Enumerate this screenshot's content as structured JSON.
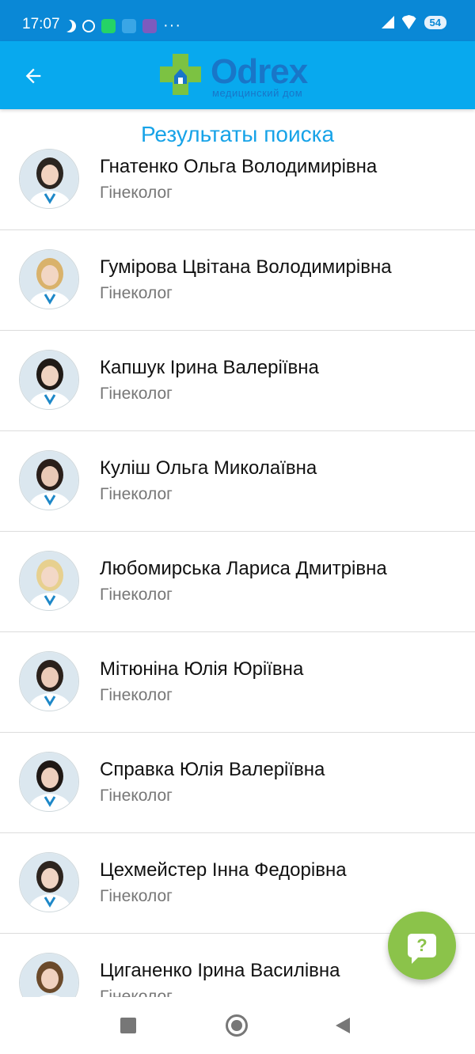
{
  "status_bar": {
    "time": "17:07",
    "dots": "···",
    "battery": "54"
  },
  "header": {
    "logo_word": "Odrex",
    "logo_sub": "медицинский дом"
  },
  "page_title": "Результаты поиска",
  "doctors": [
    {
      "name": "Гнатенко Ольга Володимирівна",
      "specialty": "Гінеколог",
      "hair": "#2b2520",
      "skin": "#f1d3c0"
    },
    {
      "name": "Гумірова Цвітана Володимирівна",
      "specialty": "Гінеколог",
      "hair": "#d9b26b",
      "skin": "#f2d6c4"
    },
    {
      "name": "Капшук Ірина Валеріївна",
      "specialty": "Гінеколог",
      "hair": "#201a16",
      "skin": "#efd3c1"
    },
    {
      "name": "Куліш Ольга Миколаївна",
      "specialty": "Гінеколог",
      "hair": "#2a1f1a",
      "skin": "#e9c9b6"
    },
    {
      "name": "Любомирська Лариса Дмитрівна",
      "specialty": "Гінеколог",
      "hair": "#e7d08f",
      "skin": "#f3d8c7"
    },
    {
      "name": "Мітюніна Юлія Юріївна",
      "specialty": "Гінеколог",
      "hair": "#2b211b",
      "skin": "#eccbb8"
    },
    {
      "name": "Справка Юлія Валеріївна",
      "specialty": "Гінеколог",
      "hair": "#1f1815",
      "skin": "#eecfbd"
    },
    {
      "name": "Цехмейстер Інна Федорівна",
      "specialty": "Гінеколог",
      "hair": "#2d241e",
      "skin": "#f0d4c3"
    },
    {
      "name": "Циганенко Ірина Василівна",
      "specialty": "Гінеколог",
      "hair": "#6b4a2b",
      "skin": "#f0d2c0"
    }
  ],
  "fab": {
    "symbol": "?"
  },
  "colors": {
    "status_bar": "#0a88d6",
    "app_bar": "#08a9ee",
    "title": "#17a3e8",
    "fab": "#8bc34a"
  }
}
